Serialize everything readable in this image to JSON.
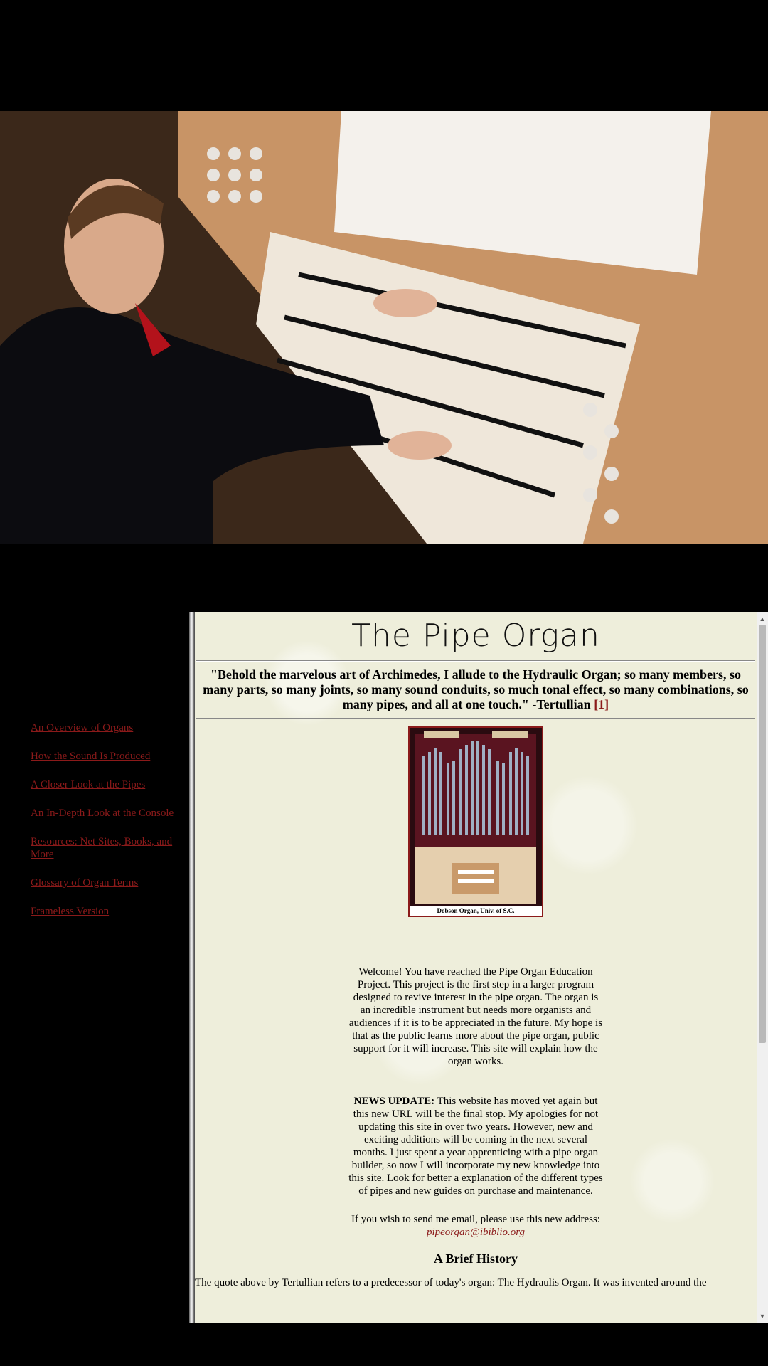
{
  "hero": {
    "icon": "organist-photo"
  },
  "sidebar": {
    "links": [
      "An Overview of Organs",
      "How the Sound Is Produced",
      "A Closer Look at the Pipes",
      "An In-Depth Look at the Console",
      "Resources: Net Sites, Books, and More",
      "Glossary of Organ Terms",
      "Frameless Version"
    ]
  },
  "main": {
    "title": "The Pipe Organ",
    "quote": "\"Behold the marvelous art of Archimedes, I allude to the Hydraulic Organ; so many members, so many parts, so many joints, so many sound conduits, so much tonal effect, so many combinations, so many pipes, and all at one touch.\" -Tertullian",
    "quote_ref": "[1]",
    "photo_caption": "Dobson Organ, Univ. of S.C.",
    "welcome": "Welcome! You have reached the Pipe Organ Education Project. This project is the first step in a larger program designed to revive interest in the pipe organ. The organ is an incredible instrument but needs more organists and audiences if it is to be appreciated in the future. My hope is that as the public learns more about the pipe organ, public support for it will increase. This site will explain how the organ works.",
    "news_label": "NEWS UPDATE:",
    "news": " This website has moved yet again but this new URL will be the final stop. My apologies for not updating this site in over two years. However, new and exciting additions will be coming in the next several months. I just spent a year apprenticing with a pipe organ builder, so now I will incorporate my new knowledge into this site. Look for better a explanation of the different types of pipes and new guides on purchase and maintenance.",
    "email_text": "If you wish to send me email, please use this new address:",
    "email": "pipeorgan@ibiblio.org",
    "history_heading": "A Brief History",
    "history": "The quote above by Tertullian refers to a predecessor of today's organ: The Hydraulis Organ. It was invented around the"
  },
  "colors": {
    "link": "#8b1a1a",
    "content_bg": "#eeeedb"
  }
}
